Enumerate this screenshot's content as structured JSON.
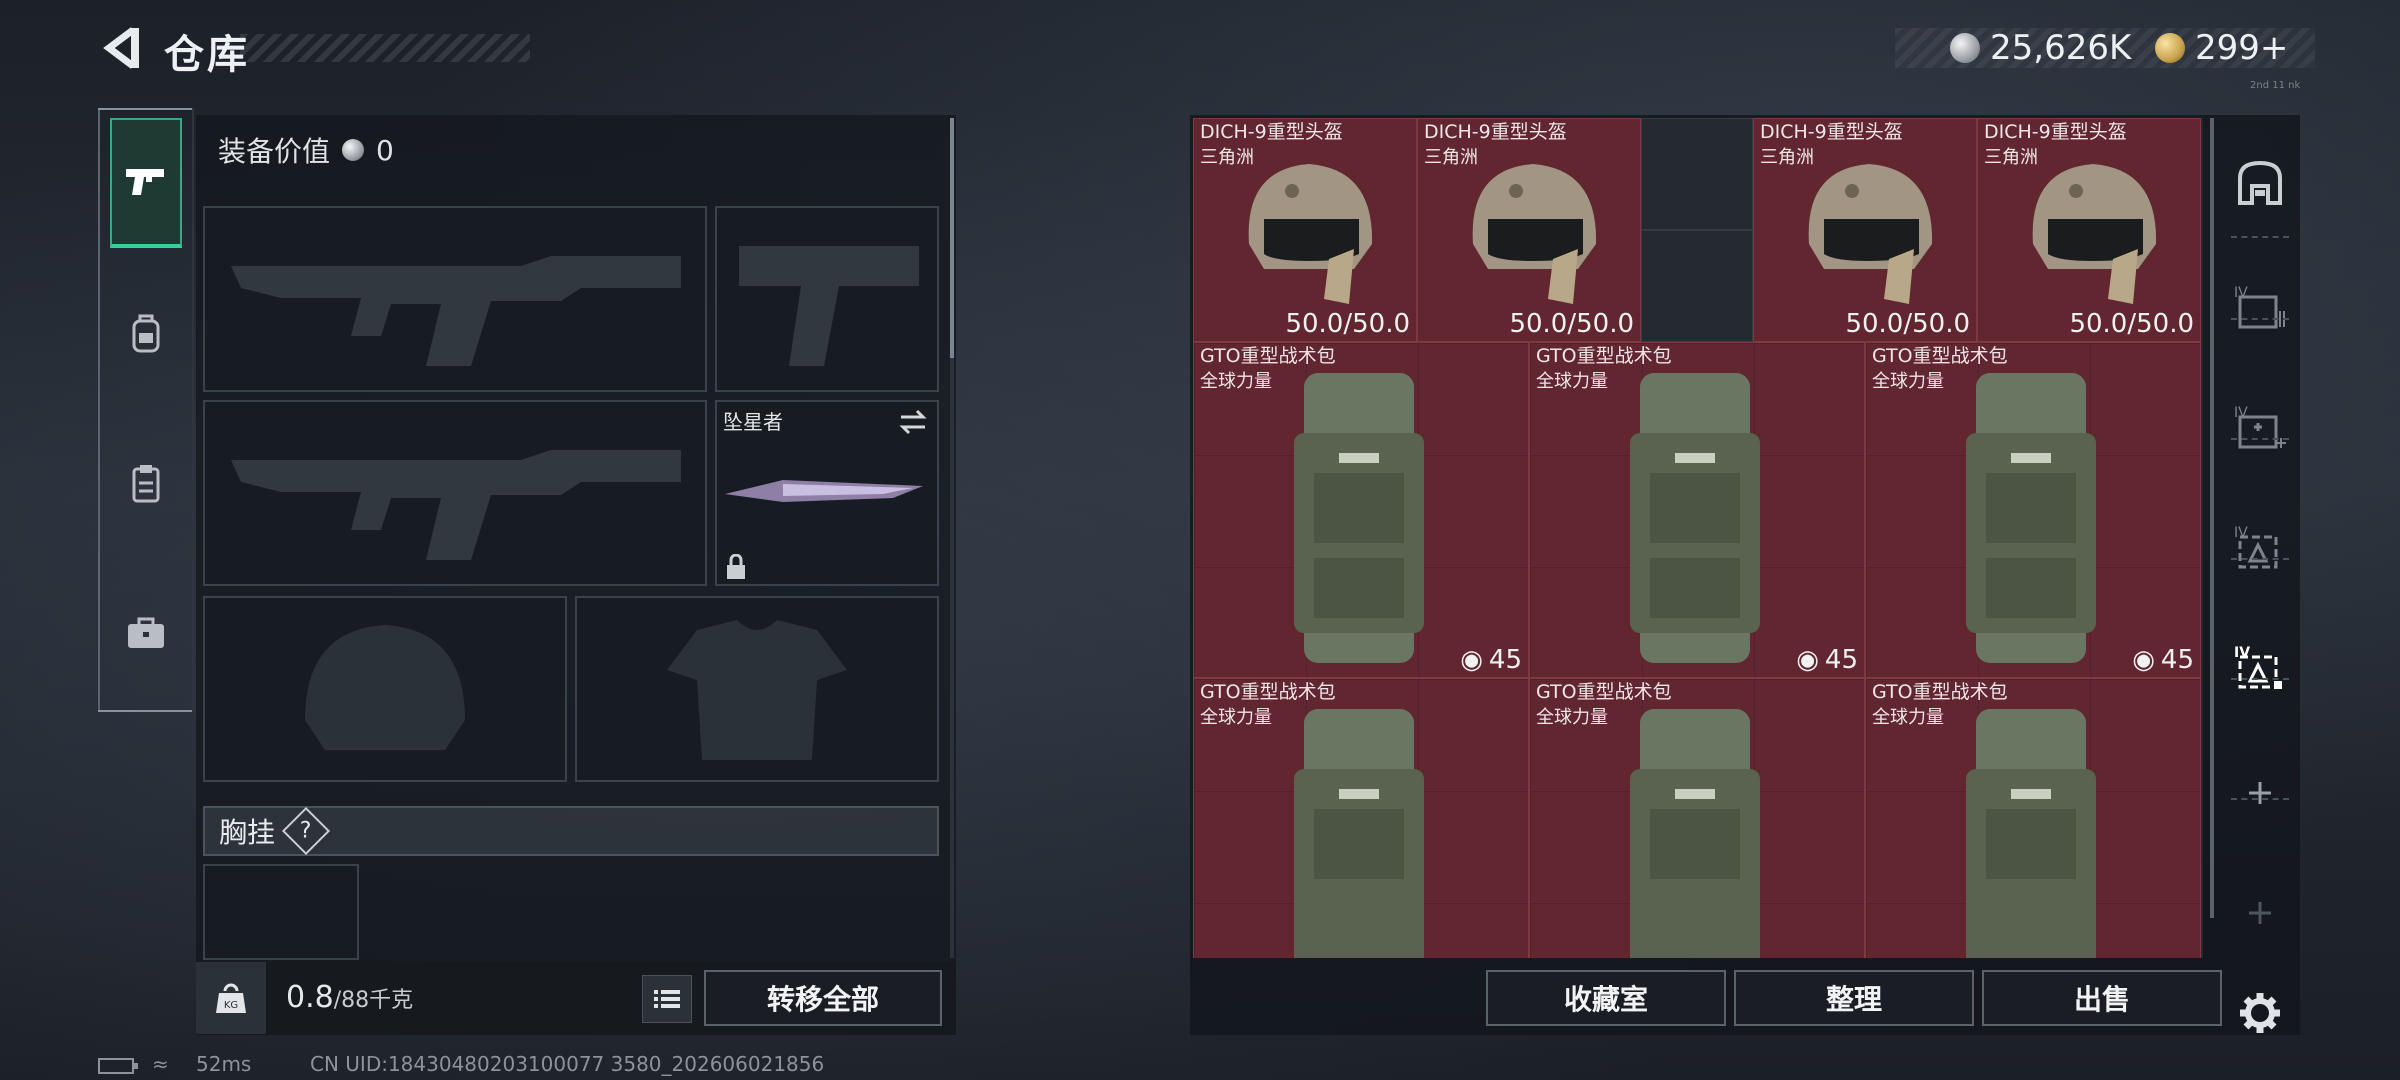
{
  "header": {
    "title": "仓库",
    "currency": [
      {
        "icon": "silver-coin-icon",
        "value": "25,626K"
      },
      {
        "icon": "gold-coin-icon",
        "value": "299+"
      }
    ],
    "tiny_text": "2nd 11 nk"
  },
  "left_tabs": [
    {
      "name": "weapons",
      "icon": "pistol-icon",
      "active": true
    },
    {
      "name": "gear",
      "icon": "backpack-icon",
      "active": false
    },
    {
      "name": "consumables",
      "icon": "clipboard-icon",
      "active": false
    },
    {
      "name": "briefcase",
      "icon": "briefcase-icon",
      "active": false
    }
  ],
  "equipment": {
    "value_label": "装备价值",
    "value": "0",
    "melee_name": "坠星者",
    "chest_label": "胸挂",
    "help_symbol": "?",
    "weight_value": "0.8",
    "weight_max": "/88千克",
    "transfer_all": "转移全部"
  },
  "storage": {
    "helmets": [
      {
        "name": "DICH-9重型头盔",
        "sub": "三角洲",
        "durability": "50.0/50.0"
      },
      {
        "name": "DICH-9重型头盔",
        "sub": "三角洲",
        "durability": "50.0/50.0"
      },
      {
        "name": "DICH-9重型头盔",
        "sub": "三角洲",
        "durability": "50.0/50.0"
      },
      {
        "name": "DICH-9重型头盔",
        "sub": "三角洲",
        "durability": "50.0/50.0"
      }
    ],
    "backpacks_row1": [
      {
        "name": "GTO重型战术包",
        "sub": "全球力量",
        "capacity": "45"
      },
      {
        "name": "GTO重型战术包",
        "sub": "全球力量",
        "capacity": "45"
      },
      {
        "name": "GTO重型战术包",
        "sub": "全球力量",
        "capacity": "45"
      }
    ],
    "backpacks_row2": [
      {
        "name": "GTO重型战术包",
        "sub": "全球力量"
      },
      {
        "name": "GTO重型战术包",
        "sub": "全球力量"
      },
      {
        "name": "GTO重型战术包",
        "sub": "全球力量"
      }
    ],
    "side_labels": [
      "IV",
      "IV",
      "IV",
      "IV"
    ],
    "buttons": {
      "collection": "收藏室",
      "organize": "整理",
      "sell": "出售"
    }
  },
  "status": {
    "ping": "52ms",
    "uid": "CN UID:18430480203100077 3580_202606021856"
  },
  "colors": {
    "item_bg": "#612630",
    "active_tab": "#36d09a"
  }
}
